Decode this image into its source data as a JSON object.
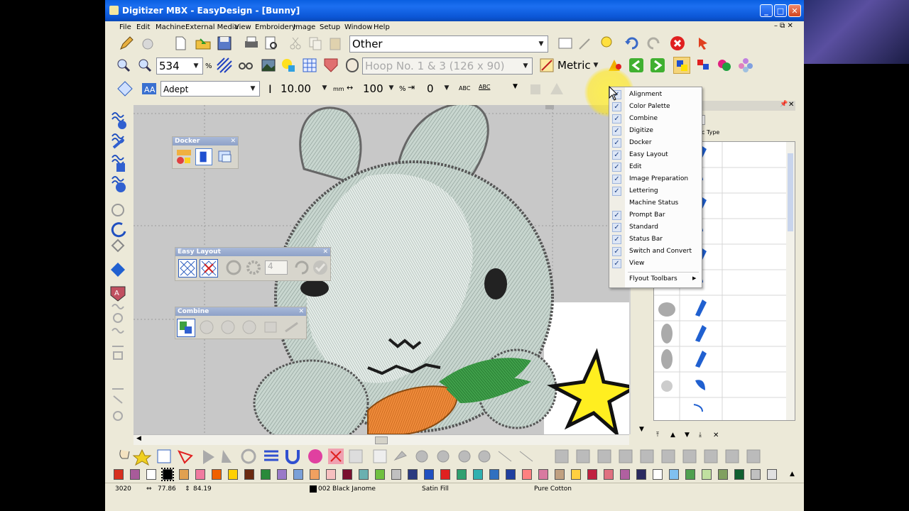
{
  "window": {
    "title": "Digitizer MBX - EasyDesign - [Bunny]",
    "controls": [
      "minimize",
      "maximize",
      "close"
    ]
  },
  "menubar": {
    "items": [
      "File",
      "Edit",
      "Machine",
      "External Media",
      "View",
      "Embroidery",
      "Image",
      "Setup",
      "Window",
      "Help"
    ]
  },
  "toolbar1": {
    "design_type": "Other"
  },
  "toolbar2": {
    "zoom": "534",
    "zoom_unit": "%",
    "hoop": "Hoop No. 1 & 3 (126 x 90)",
    "measurement": "Metric"
  },
  "toolbar3": {
    "font": "Adept",
    "height": "10.00",
    "height_unit": "mm",
    "width": "100",
    "width_unit": "%",
    "spacing": "0"
  },
  "floating": {
    "docker_title": "Docker",
    "easy_layout_title": "Easy Layout",
    "easy_layout_count": "4",
    "combine_title": "Combine"
  },
  "docker_panel": {
    "column_type_label": "c Type"
  },
  "context_menu": {
    "items": [
      {
        "label": "Alignment",
        "checked": true
      },
      {
        "label": "Color Palette",
        "checked": true
      },
      {
        "label": "Combine",
        "checked": true
      },
      {
        "label": "Digitize",
        "checked": true
      },
      {
        "label": "Docker",
        "checked": true
      },
      {
        "label": "Easy Layout",
        "checked": true
      },
      {
        "label": "Edit",
        "checked": true
      },
      {
        "label": "Image Preparation",
        "checked": true
      },
      {
        "label": "Lettering",
        "checked": true
      },
      {
        "label": "Machine Status",
        "checked": false
      },
      {
        "label": "Prompt Bar",
        "checked": true
      },
      {
        "label": "Standard",
        "checked": true
      },
      {
        "label": "Status Bar",
        "checked": true
      },
      {
        "label": "Switch and Convert",
        "checked": true
      },
      {
        "label": "View",
        "checked": true
      }
    ],
    "submenu": "Flyout Toolbars"
  },
  "palette": {
    "colors": [
      "#d7301f",
      "#a85b9a",
      "#ffffff",
      "#000000",
      "#e0a050",
      "#f07aa0",
      "#f06000",
      "#ffd000",
      "#6b2a10",
      "#2a8a3a",
      "#9a7ac8",
      "#7aa0d8",
      "#f0a060",
      "#f7c0c0",
      "#7a1030",
      "#6ab0b0",
      "#70c040",
      "#c0c0c0",
      "#2a3a80",
      "#2050c0",
      "#e02020",
      "#30a070",
      "#30b0b0",
      "#3070c0",
      "#2040a0",
      "#ff8080",
      "#d87aa0",
      "#c0a080",
      "#ffd040",
      "#c02040",
      "#e07080",
      "#b060a0",
      "#2a2a60",
      "#ffffff",
      "#80c0f0",
      "#50a050",
      "#c0e0a0",
      "#80a060",
      "#106030",
      "#c0c0c0",
      "#e0e0e0"
    ]
  },
  "statusbar": {
    "stitches": "3020",
    "width": "77.86",
    "height": "84.19",
    "thread": "002 Black Janome",
    "fill": "Satin Fill",
    "material": "Pure Cotton"
  }
}
